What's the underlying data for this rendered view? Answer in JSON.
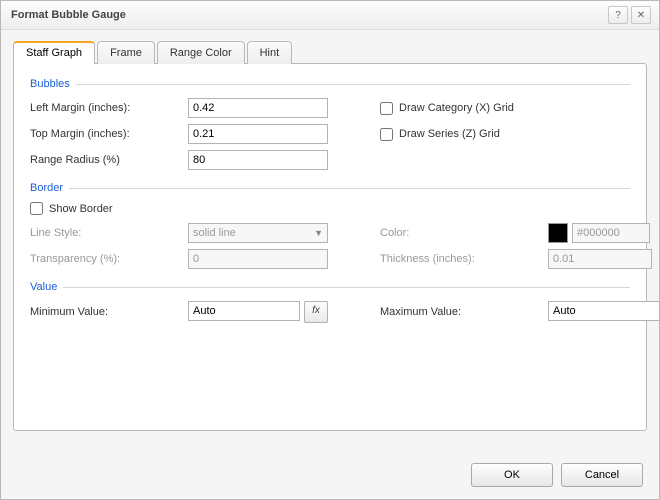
{
  "dialog": {
    "title": "Format Bubble Gauge"
  },
  "tabs": {
    "staff_graph": "Staff Graph",
    "frame": "Frame",
    "range_color": "Range Color",
    "hint": "Hint"
  },
  "sections": {
    "bubbles": "Bubbles",
    "border": "Border",
    "value": "Value"
  },
  "labels": {
    "left_margin": "Left Margin (inches):",
    "top_margin": "Top Margin (inches):",
    "range_radius": "Range Radius (%)",
    "draw_category_grid": "Draw Category (X) Grid",
    "draw_series_grid": "Draw Series (Z) Grid",
    "show_border": "Show Border",
    "line_style": "Line Style:",
    "transparency": "Transparency (%):",
    "color": "Color:",
    "thickness": "Thickness (inches):",
    "min_value": "Minimum Value:",
    "max_value": "Maximum Value:"
  },
  "values": {
    "left_margin": "0.42",
    "top_margin": "0.21",
    "range_radius": "80",
    "line_style": "solid line",
    "transparency": "0",
    "color_hex": "#000000",
    "color_swatch": "#000000",
    "thickness": "0.01",
    "min_value": "Auto",
    "max_value": "Auto"
  },
  "buttons": {
    "ok": "OK",
    "cancel": "Cancel",
    "fx": "fx",
    "help": "?",
    "close": "✕"
  }
}
